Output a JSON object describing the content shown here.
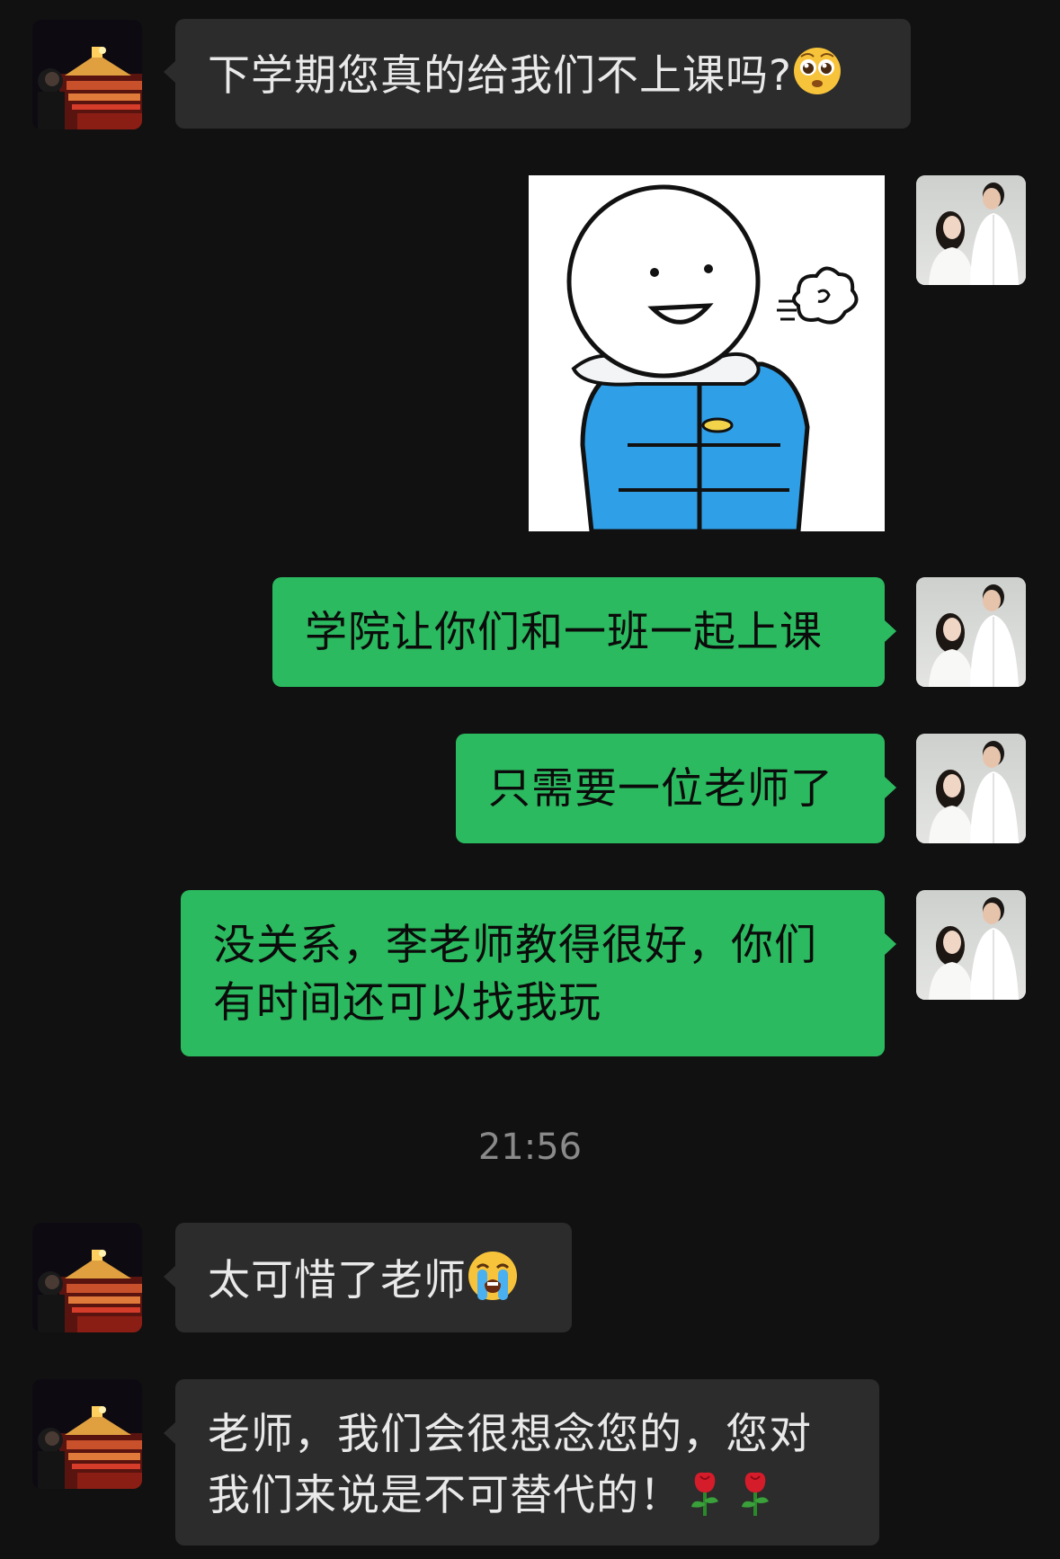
{
  "messages": {
    "m1": "下学期您真的给我们不上课吗?",
    "m3": "学院让你们和一班一起上课",
    "m4": "只需要一位老师了",
    "m5_line1": "没关系，李老师教得很好，你们",
    "m5_line2": "有时间还可以找我玩",
    "m6": "太可惜了老师",
    "m7_line1": "老师，我们会很想念您的，您对",
    "m7_line2": "我们来说是不可替代的！"
  },
  "timestamp": "21:56",
  "icons": {
    "pleading": "pleading-face-emoji",
    "crying": "loudly-crying-face-emoji",
    "rose": "rose-emoji"
  },
  "colors": {
    "background": "#111111",
    "incoming_bubble": "#2c2c2c",
    "outgoing_bubble": "#2bba5f",
    "timestamp": "#8a8a8a"
  }
}
